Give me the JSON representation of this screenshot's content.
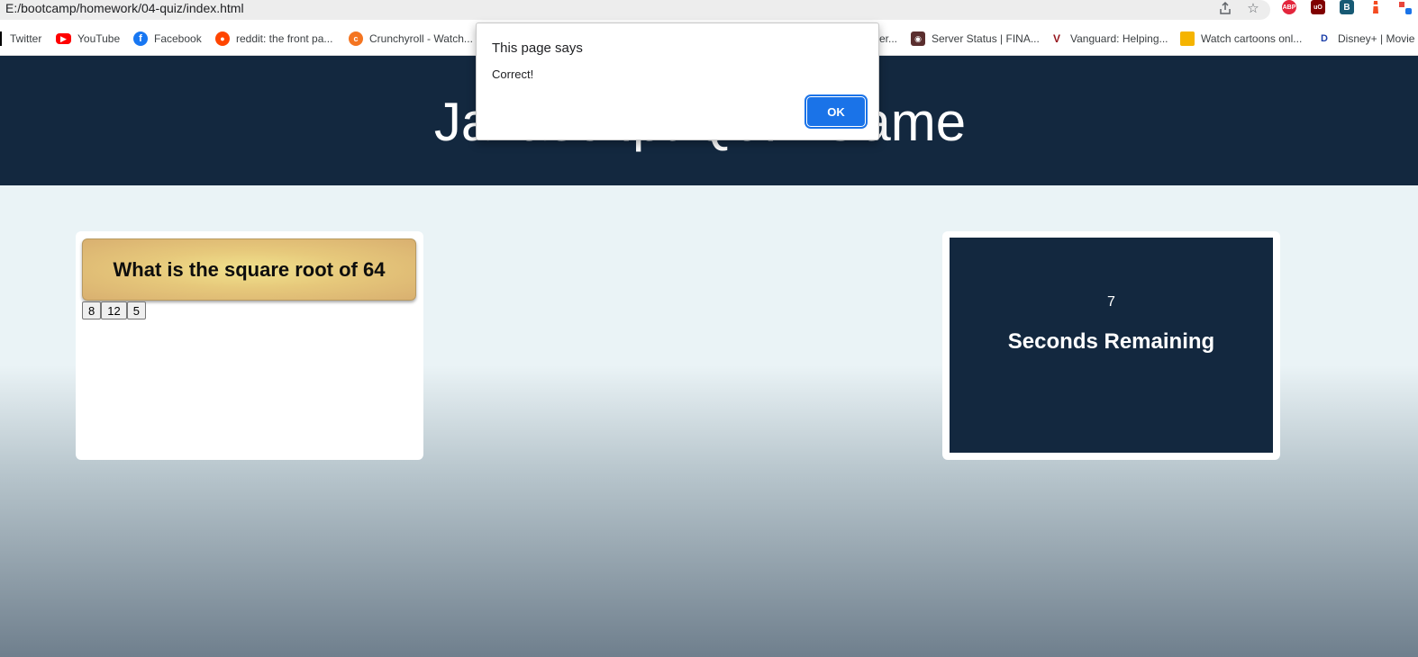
{
  "browser": {
    "url": "E:/bootcamp/homework/04-quiz/index.html",
    "bookmarks": [
      {
        "label": "Twitter",
        "icon": "twitter-icon"
      },
      {
        "label": "YouTube",
        "icon": "youtube-icon",
        "color": "#ff0000"
      },
      {
        "label": "Facebook",
        "icon": "facebook-icon",
        "color": "#1877f2"
      },
      {
        "label": "reddit: the front pa...",
        "icon": "reddit-icon",
        "color": "#ff4500"
      },
      {
        "label": "Crunchyroll - Watch...",
        "icon": "crunchyroll-icon",
        "color": "#f47521"
      },
      {
        "label": "er...",
        "icon": ""
      },
      {
        "label": "Server Status | FINA...",
        "icon": "server-status-icon",
        "color": "#5a2e2e"
      },
      {
        "label": "Vanguard: Helping...",
        "icon": "vanguard-icon",
        "color": "#96151d"
      },
      {
        "label": "Watch cartoons onl...",
        "icon": "cartoons-icon",
        "color": "#f5b400"
      },
      {
        "label": "Disney+ | Movie",
        "icon": "disney-icon",
        "color": "#1a3ea8"
      }
    ],
    "extensions": [
      {
        "label": "ABP",
        "name": "adblock-plus-icon",
        "color": "#e3253c"
      },
      {
        "label": "uO",
        "name": "ublock-origin-icon",
        "color": "#800000"
      },
      {
        "label": "B",
        "name": "bitwarden-extension-icon",
        "color": "#175a74"
      },
      {
        "label": "",
        "name": "lighthouse-extension-icon",
        "color": "#f44b21"
      },
      {
        "label": "",
        "name": "profile-extension-icon",
        "color": "#e8453c"
      }
    ]
  },
  "page": {
    "header_title": "Javascript Quiz Game",
    "question": "What is the square root of 64",
    "answers": [
      "8",
      "12",
      "5"
    ],
    "timer": {
      "count": "7",
      "label": "Seconds Remaining"
    },
    "colors": {
      "header_bg": "#13283f",
      "timer_bg": "#13283f",
      "question_gold": "#e6c87b"
    }
  },
  "dialog": {
    "title": "This page says",
    "message": "Correct!",
    "ok_label": "OK",
    "ok_color": "#1a73e8"
  }
}
